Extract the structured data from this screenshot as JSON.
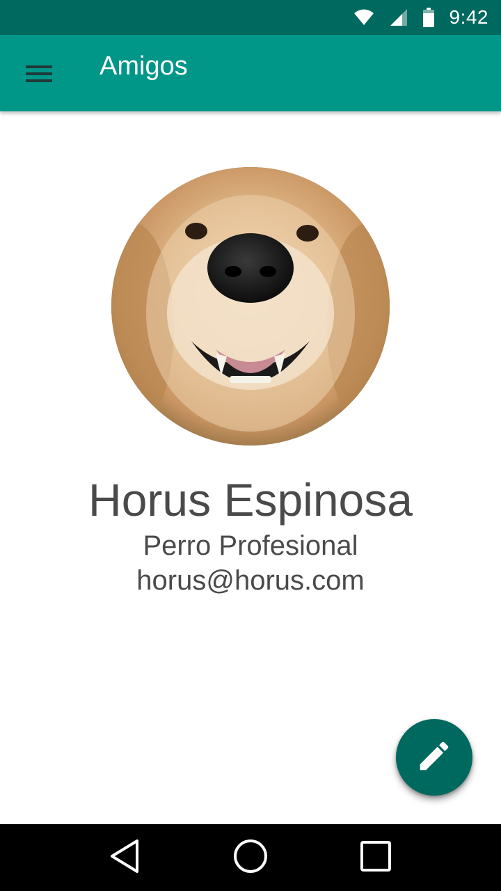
{
  "status_bar": {
    "time": "9:42",
    "icons": [
      "wifi-icon",
      "signal-icon",
      "battery-icon"
    ]
  },
  "app_bar": {
    "title": "Amigos",
    "menu_icon": "hamburger-menu-icon",
    "color": "#009688"
  },
  "profile": {
    "name": "Horus Espinosa",
    "role": "Perro Profesional",
    "email": "horus@horus.com",
    "avatar": "dog-photo-avatar"
  },
  "fab": {
    "icon": "edit-pencil-icon",
    "color": "#00695f"
  },
  "nav_bar": {
    "icons": [
      "back-icon",
      "home-icon",
      "recents-icon"
    ]
  },
  "colors": {
    "primary": "#009688",
    "primary_dark": "#00695f",
    "text": "#4a4a4a"
  }
}
